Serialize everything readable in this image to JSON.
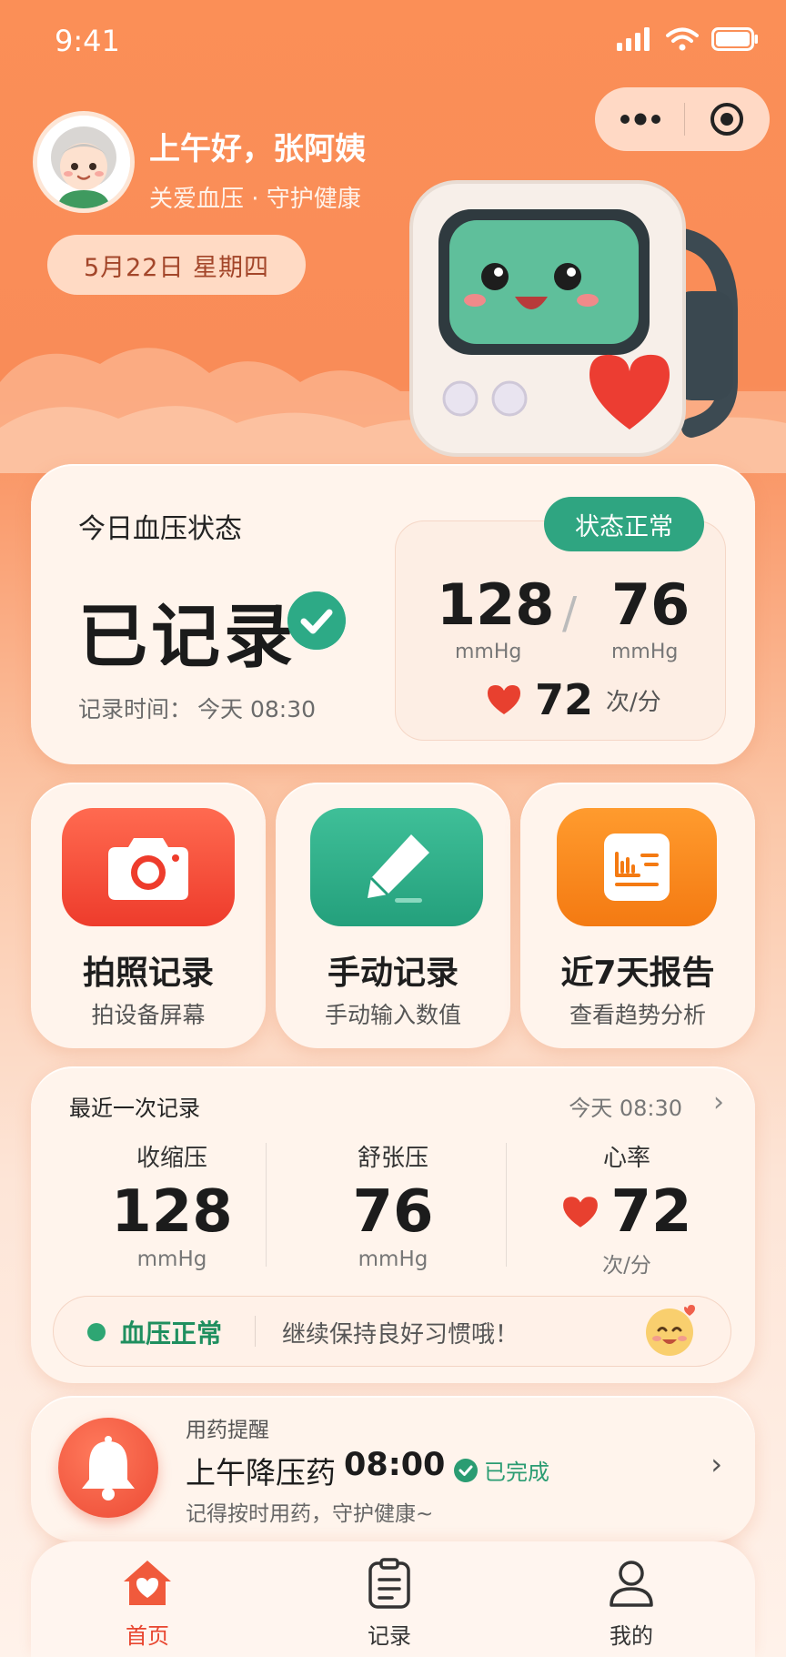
{
  "status_bar": {
    "time": "9:41"
  },
  "header": {
    "greeting": "上午好，张阿姨",
    "subtitle": "关爱血压 · 守护健康",
    "date": "5月22日  星期四"
  },
  "today_status": {
    "title": "今日血压状态",
    "state": "已记录",
    "time_label": "记录时间：",
    "time_value": "今天 08:30",
    "badge": "状态正常",
    "systolic": "128",
    "diastolic": "76",
    "unit_pressure": "mmHg",
    "separator": "/",
    "heart_rate": "72",
    "heart_rate_unit": "次/分"
  },
  "actions": [
    {
      "title": "拍照记录",
      "subtitle": "拍设备屏幕",
      "icon": "camera-icon",
      "color": "#f14a36"
    },
    {
      "title": "手动记录",
      "subtitle": "手动输入数值",
      "icon": "pencil-icon",
      "color": "#2fae8b"
    },
    {
      "title": "近7天报告",
      "subtitle": "查看趋势分析",
      "icon": "report-chart-icon",
      "color": "#f7841d"
    }
  ],
  "recent_record": {
    "title": "最近一次记录",
    "time": "今天 08:30",
    "metrics": [
      {
        "label": "收缩压",
        "value": "128",
        "unit": "mmHg"
      },
      {
        "label": "舒张压",
        "value": "76",
        "unit": "mmHg"
      },
      {
        "label": "心率",
        "value": "72",
        "unit": "次/分"
      }
    ],
    "tip_status": "血压正常",
    "tip_text": "继续保持良好习惯哦！"
  },
  "medication": {
    "label": "用药提醒",
    "name": "上午降压药",
    "time": "08:00",
    "status": "已完成",
    "tip": "记得按时用药，守护健康~"
  },
  "tab_bar": {
    "tabs": [
      {
        "label": "首页",
        "icon": "home-heart-icon",
        "active": true
      },
      {
        "label": "记录",
        "icon": "clipboard-icon",
        "active": false
      },
      {
        "label": "我的",
        "icon": "user-icon",
        "active": false
      }
    ]
  },
  "colors": {
    "accent": "#f15a3a",
    "success": "#2fa581",
    "heart": "#e8402f"
  }
}
